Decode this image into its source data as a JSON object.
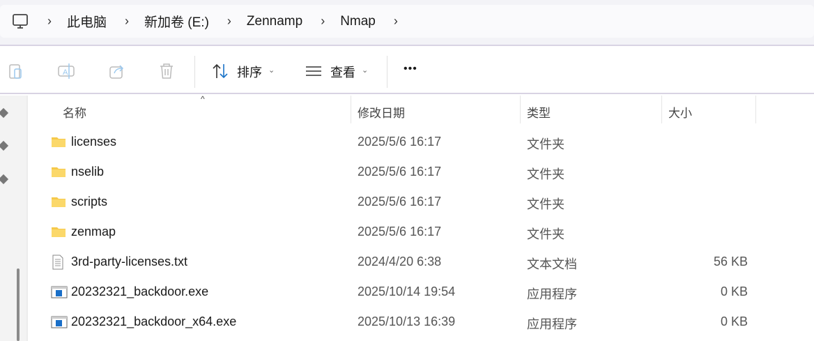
{
  "breadcrumb": [
    "此电脑",
    "新加卷 (E:)",
    "Zennamp",
    "Nmap"
  ],
  "toolbar": {
    "sort_label": "排序",
    "view_label": "查看",
    "more_label": "•••"
  },
  "columns": {
    "name": "名称",
    "date": "修改日期",
    "type": "类型",
    "size": "大小"
  },
  "files": [
    {
      "icon": "folder-icon",
      "name": "licenses",
      "date": "2025/5/6 16:17",
      "type": "文件夹",
      "size": ""
    },
    {
      "icon": "folder-icon",
      "name": "nselib",
      "date": "2025/5/6 16:17",
      "type": "文件夹",
      "size": ""
    },
    {
      "icon": "folder-icon",
      "name": "scripts",
      "date": "2025/5/6 16:17",
      "type": "文件夹",
      "size": ""
    },
    {
      "icon": "folder-icon",
      "name": "zenmap",
      "date": "2025/5/6 16:17",
      "type": "文件夹",
      "size": ""
    },
    {
      "icon": "text-file-icon",
      "name": "3rd-party-licenses.txt",
      "date": "2024/4/20 6:38",
      "type": "文本文档",
      "size": "56 KB"
    },
    {
      "icon": "exe-icon",
      "name": "20232321_backdoor.exe",
      "date": "2025/10/14 19:54",
      "type": "应用程序",
      "size": "0 KB"
    },
    {
      "icon": "exe-icon",
      "name": "20232321_backdoor_x64.exe",
      "date": "2025/10/13 16:39",
      "type": "应用程序",
      "size": "0 KB"
    }
  ]
}
